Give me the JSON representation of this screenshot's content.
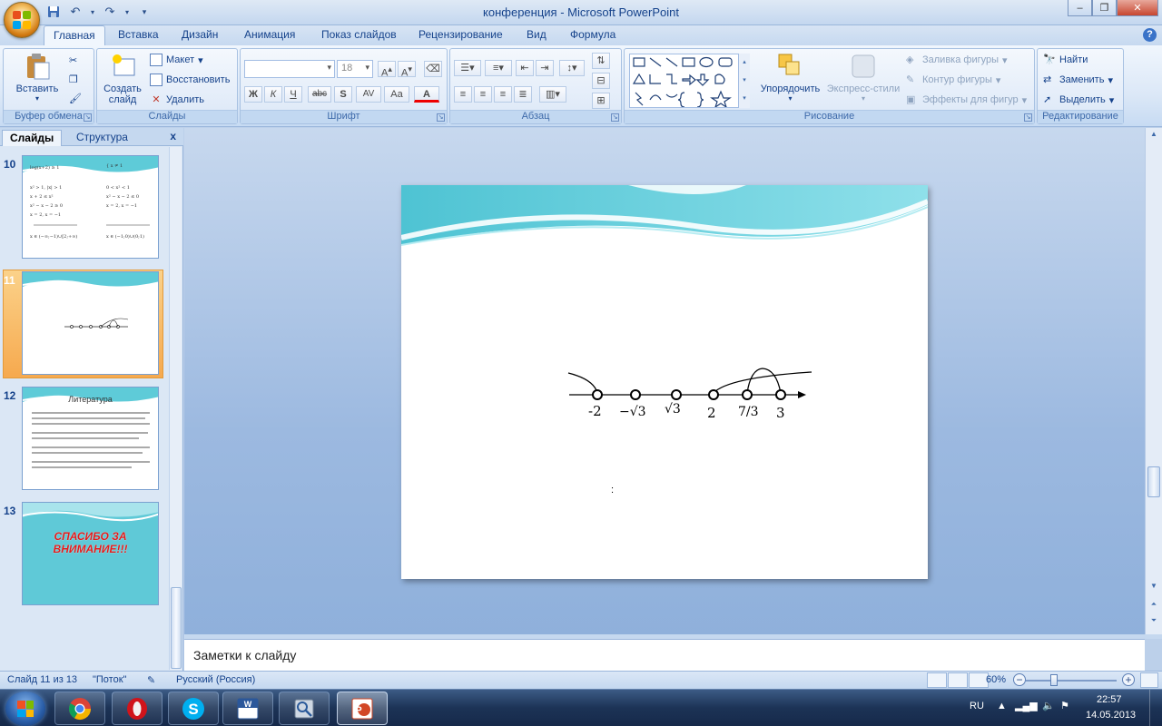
{
  "window": {
    "title": "конференция - Microsoft PowerPoint",
    "minimize_icon": "minimize-icon",
    "maximize_icon": "restore-icon",
    "close_icon": "close-icon"
  },
  "quick_access": [
    "save-icon",
    "undo-icon",
    "redo-icon",
    "customize-icon"
  ],
  "ribbon_tabs": [
    {
      "label": "Главная",
      "active": true
    },
    {
      "label": "Вставка"
    },
    {
      "label": "Дизайн"
    },
    {
      "label": "Анимация"
    },
    {
      "label": "Показ слайдов"
    },
    {
      "label": "Рецензирование"
    },
    {
      "label": "Вид"
    },
    {
      "label": "Формула"
    }
  ],
  "ribbon": {
    "clipboard": {
      "label": "Буфер обмена",
      "paste": "Вставить"
    },
    "slides": {
      "label": "Слайды",
      "new_slide": "Создать слайд",
      "layout": "Макет",
      "reset": "Восстановить",
      "delete": "Удалить"
    },
    "font": {
      "label": "Шрифт",
      "font_name": "",
      "font_size": "18",
      "bold": "Ж",
      "italic": "К",
      "underline": "Ч",
      "strike": "abc",
      "shadow": "S",
      "spacing": "AV",
      "case": "Aa",
      "color": "A"
    },
    "paragraph": {
      "label": "Абзац"
    },
    "drawing": {
      "label": "Рисование",
      "arrange": "Упорядочить",
      "quick_styles": "Экспресс-стили",
      "fill": "Заливка фигуры",
      "outline": "Контур фигуры",
      "effects": "Эффекты для фигур"
    },
    "editing": {
      "label": "Редактирование",
      "find": "Найти",
      "replace": "Заменить",
      "select": "Выделить"
    }
  },
  "slide_pane": {
    "tabs": [
      {
        "label": "Слайды",
        "active": true
      },
      {
        "label": "Структура"
      }
    ],
    "close": "x",
    "thumbnails": [
      {
        "number": "10"
      },
      {
        "number": "11",
        "selected": true
      },
      {
        "number": "12",
        "title": "Литература"
      },
      {
        "number": "13",
        "text": "СПАСИБО ЗА ВНИМАНИЕ!!!"
      }
    ]
  },
  "slide": {
    "number_line": {
      "points": [
        "-2",
        "−√3",
        "√3",
        "2",
        "7/3",
        "3"
      ],
      "cursor_text": ":"
    }
  },
  "notes": {
    "placeholder": "Заметки к слайду"
  },
  "status_bar": {
    "slide_info": "Слайд 11 из 13",
    "theme": "\"Поток\"",
    "language": "Русский (Россия)",
    "zoom": "60%"
  },
  "taskbar": {
    "apps": [
      "chrome-icon",
      "opera-icon",
      "skype-icon",
      "word-icon",
      "search-app-icon",
      "powerpoint-icon"
    ],
    "tray": {
      "language": "RU",
      "time": "22:57",
      "date": "14.05.2013"
    }
  },
  "colors": {
    "accent": "#15428b",
    "ribbon": "#dce8f7",
    "selected": "#f6a94e"
  }
}
